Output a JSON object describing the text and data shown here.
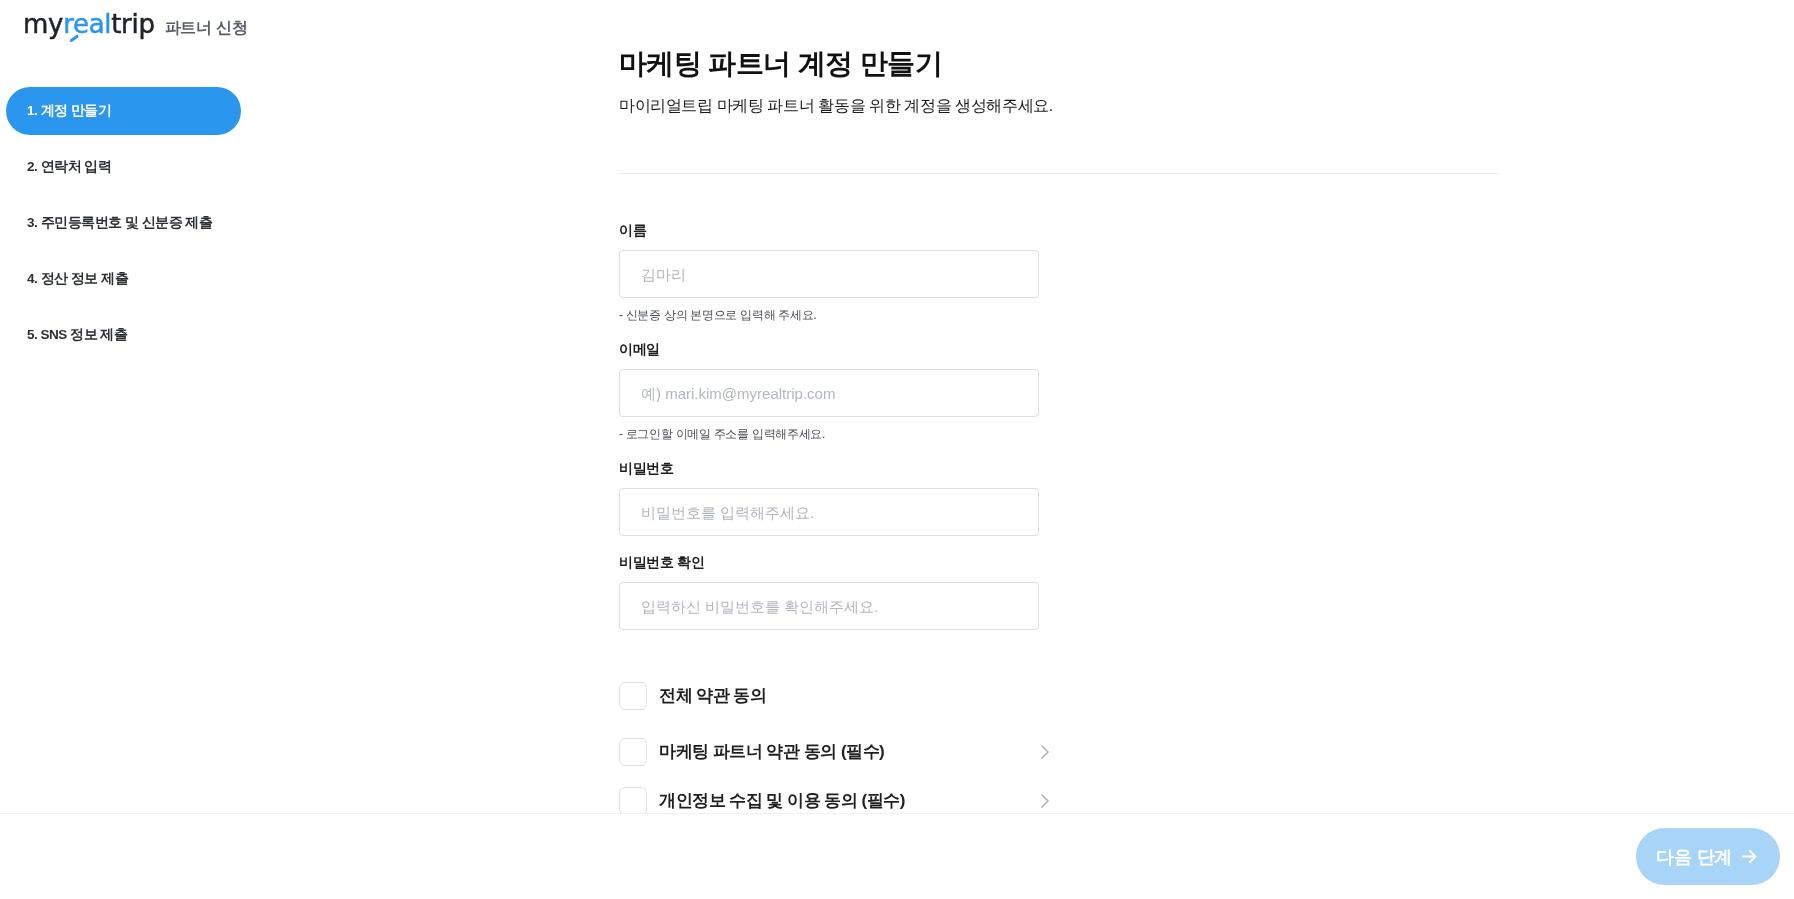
{
  "logo": {
    "parts": [
      {
        "text": "my",
        "accent": false
      },
      {
        "text": "real",
        "accent": true
      },
      {
        "text": "trip",
        "accent": false
      }
    ],
    "caption": "파트너 신청"
  },
  "sidebar": {
    "items": [
      {
        "label": "1. 계정 만들기",
        "selected": true
      },
      {
        "label": "2. 연락처 입력",
        "selected": false
      },
      {
        "label": "3. 주민등록번호 및 신분증 제출",
        "selected": false
      },
      {
        "label": "4. 정산 정보 제출",
        "selected": false
      },
      {
        "label": "5. SNS 정보 제출",
        "selected": false
      }
    ]
  },
  "header": {
    "title": "마케팅 파트너 계정 만들기",
    "subtitle": "마이리얼트립 마케팅 파트너 활동을 위한 계정을 생성해주세요."
  },
  "form": {
    "fields": [
      {
        "label": "이름",
        "placeholder": "김마리",
        "hint": "- 신분증 상의 본명으로 입력해 주세요."
      },
      {
        "label": "이메일",
        "placeholder": "예) mari.kim@myrealtrip.com",
        "hint": "- 로그인할 이메일 주소를 입력해주세요."
      },
      {
        "label": "비밀번호",
        "placeholder": "비밀번호를 입력해주세요."
      },
      {
        "label": "비밀번호 확인",
        "placeholder": "입력하신 비밀번호를 확인해주세요."
      }
    ]
  },
  "agreements": [
    {
      "kind": "all",
      "label": "전체 약관 동의",
      "checked": false
    },
    {
      "kind": "term",
      "label": "마케팅 파트너 약관 동의 (필수)",
      "checked": false
    },
    {
      "kind": "term",
      "label": "개인정보 수집 및 이용 동의 (필수)",
      "checked": false
    }
  ],
  "footer": {
    "next_button": {
      "label": "다음 단계",
      "disabled": true
    }
  }
}
